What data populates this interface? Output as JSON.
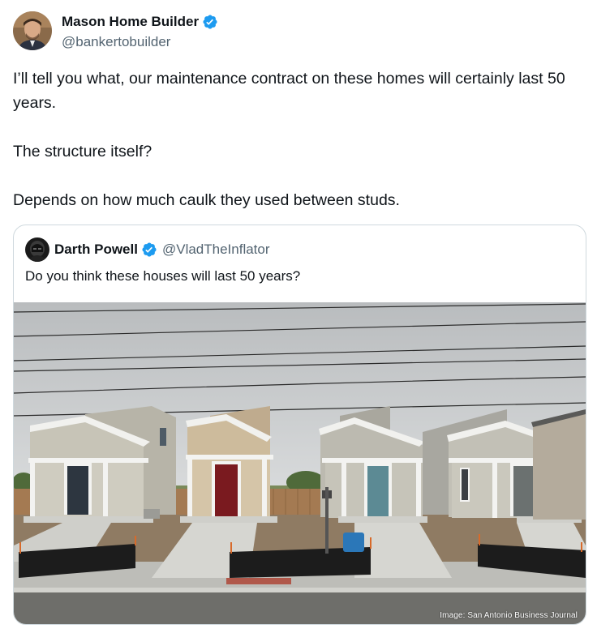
{
  "tweet": {
    "author": {
      "display_name": "Mason Home Builder",
      "handle": "@bankertobuilder",
      "verified": true,
      "avatar_icon": "profile-photo"
    },
    "paragraphs": [
      "I’ll tell you what, our maintenance contract on these homes will certainly last 50 years.",
      "The structure itself?",
      "Depends on how much caulk they used between studs."
    ]
  },
  "quoted_tweet": {
    "author": {
      "display_name": "Darth Powell",
      "handle": "@VladTheInflator",
      "verified": true,
      "avatar_icon": "dark-helmet-avatar"
    },
    "text": "Do you think these houses will last 50 years?",
    "image": {
      "description_icon": "tiny-houses-photo",
      "credit": "Image: San Antonio Business Journal"
    }
  },
  "colors": {
    "verified_blue": "#1d9bf0",
    "text_primary": "#0f1419",
    "text_secondary": "#536471",
    "border": "#cfd9de"
  }
}
